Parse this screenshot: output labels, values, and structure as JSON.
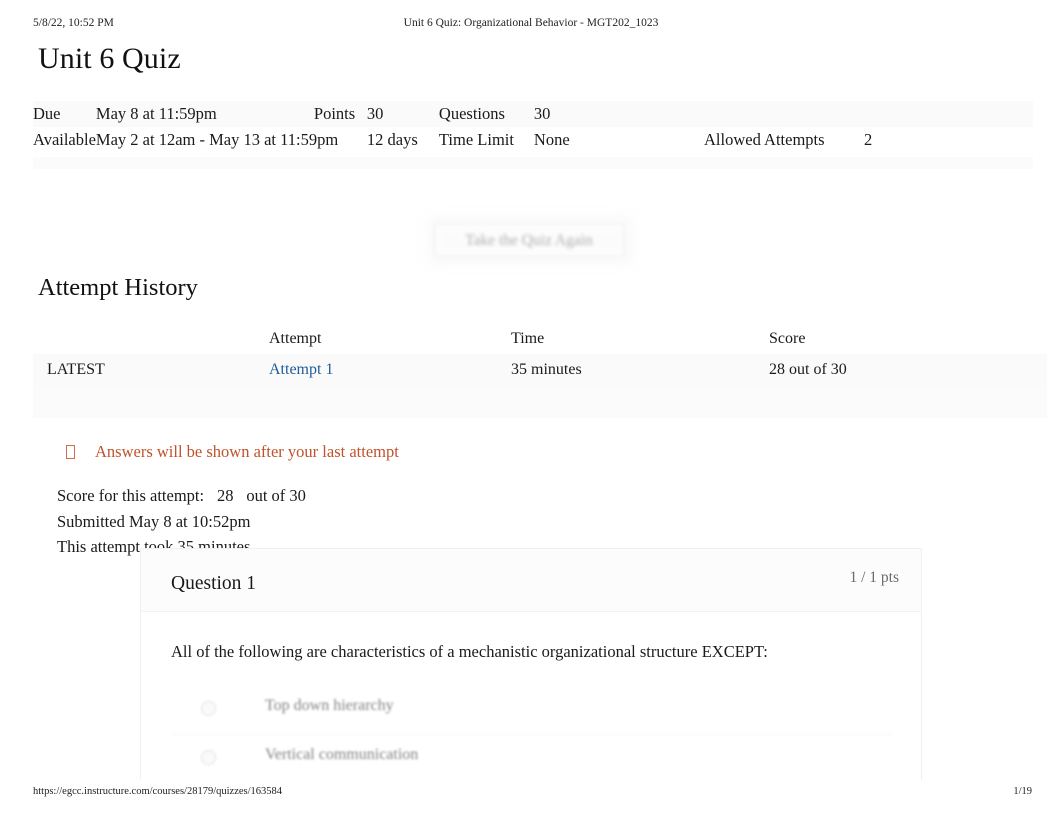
{
  "print_header": {
    "timestamp": "5/8/22, 10:52 PM",
    "document_title": "Unit 6 Quiz: Organizational Behavior - MGT202_1023"
  },
  "print_footer": {
    "url": "https://egcc.instructure.com/courses/28179/quizzes/163584",
    "page": "1/19"
  },
  "page_title": "Unit 6 Quiz",
  "quiz_details": {
    "due_label": "Due",
    "due_value": "May 8 at 11:59pm",
    "points_label": "Points",
    "points_value": "30",
    "questions_label": "Questions",
    "questions_value": "30",
    "available_label": "Available",
    "available_value": "May 2 at 12am - May 13 at 11:59pm",
    "available_duration": "12 days",
    "time_limit_label": "Time Limit",
    "time_limit_value": "None",
    "allowed_attempts_label": "Allowed Attempts",
    "allowed_attempts_value": "2"
  },
  "retake_button": {
    "label": "Take the Quiz Again"
  },
  "attempt_history": {
    "heading": "Attempt History",
    "columns": [
      "",
      "Attempt",
      "Time",
      "Score"
    ],
    "rows": [
      {
        "flag": "LATEST",
        "attempt": "Attempt 1",
        "time": "35 minutes",
        "score": "28 out of 30"
      }
    ]
  },
  "warning": {
    "icon": "info-icon",
    "text": "Answers will be shown after your last attempt",
    "color": "#c0522c"
  },
  "score_summary": {
    "score_label": "Score for this attempt:",
    "score_value": "28",
    "score_out_of": "out of 30",
    "submitted": "Submitted May 8 at 10:52pm",
    "duration": "This attempt took 35 minutes."
  },
  "question": {
    "title": "Question 1",
    "points": "1 / 1 pts",
    "prompt": "All of the following are characteristics of a mechanistic organizational structure EXCEPT:",
    "answers": [
      {
        "text": "Top down hierarchy"
      },
      {
        "text": "Vertical communication"
      }
    ]
  }
}
